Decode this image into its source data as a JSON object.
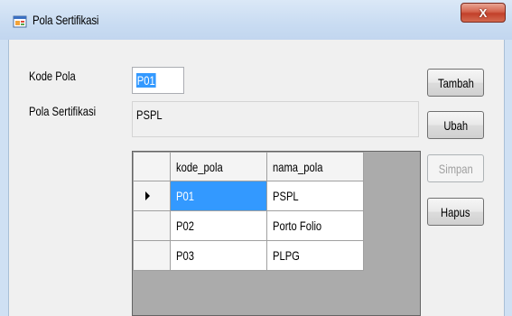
{
  "window": {
    "title": "Pola Sertifikasi",
    "close_label": "X"
  },
  "form": {
    "kode_label": "Kode Pola",
    "kode_value": "P01",
    "pola_label": "Pola Sertifikasi",
    "pola_value": "PSPL"
  },
  "buttons": {
    "tambah": "Tambah",
    "ubah": "Ubah",
    "simpan": "Simpan",
    "hapus": "Hapus"
  },
  "grid": {
    "columns": [
      "kode_pola",
      "nama_pola"
    ],
    "rows": [
      [
        "P01",
        "PSPL"
      ],
      [
        "P02",
        "Porto Folio"
      ],
      [
        "P03",
        "PLPG"
      ]
    ],
    "selected_row": 0
  },
  "colors": {
    "selection": "#3399ff",
    "close_button": "#c2402a",
    "grid_background": "#ababab"
  },
  "icons": {
    "app": "app-form-icon",
    "row_pointer": "row-pointer-icon"
  }
}
